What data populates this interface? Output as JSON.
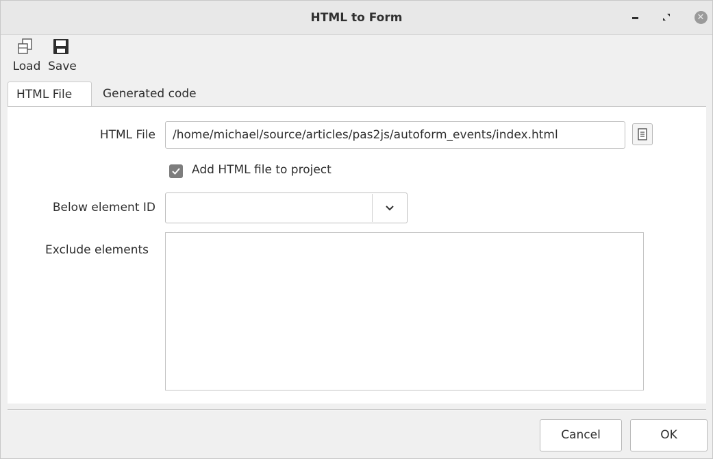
{
  "window": {
    "title": "HTML to Form",
    "controls": {
      "minimize_icon": "minimize-icon",
      "maximize_icon": "maximize-icon",
      "close_icon": "close-icon"
    }
  },
  "toolbar": {
    "load_label": "Load",
    "save_label": "Save"
  },
  "tabs": [
    {
      "label": "HTML File",
      "active": true
    },
    {
      "label": "Generated code",
      "active": false
    }
  ],
  "form": {
    "html_file_label": "HTML File",
    "html_file_value": "/home/michael/source/articles/pas2js/autoform_events/index.html",
    "add_to_project_label": "Add HTML file to project",
    "add_to_project_checked": true,
    "below_element_label": "Below element ID",
    "below_element_value": "",
    "exclude_label": "Exclude elements",
    "exclude_value": ""
  },
  "buttons": {
    "cancel_label": "Cancel",
    "ok_label": "OK"
  }
}
